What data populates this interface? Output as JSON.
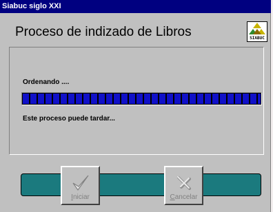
{
  "window": {
    "title": "Siabuc siglo XXI"
  },
  "header": {
    "title": "Proceso de indizado de Libros",
    "logo_text": "SIABUC"
  },
  "progress": {
    "status": "Ordenando ....",
    "percent": 100,
    "note": "Este proceso puede tardar..."
  },
  "actions": {
    "start": {
      "accel": "I",
      "rest": "niciar",
      "enabled": false,
      "icon": "checkmark-icon"
    },
    "cancel": {
      "accel": "C",
      "rest": "ancelar",
      "enabled": false,
      "icon": "cancel-x-icon"
    }
  },
  "colors": {
    "titlebar": "#000080",
    "progress_fill": "#1010c8",
    "action_bar": "#1b7a7e",
    "window": "#c0c0c0"
  }
}
